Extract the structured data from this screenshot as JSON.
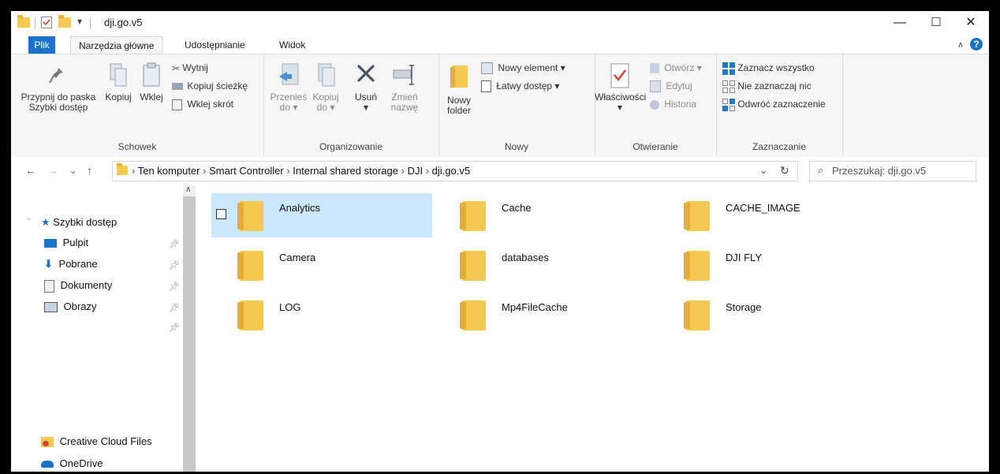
{
  "window": {
    "title": "dji.go.v5",
    "controls": {
      "minimize": "—",
      "maximize": "☐",
      "close": "✕"
    }
  },
  "tabs": [
    {
      "label": "Plik"
    },
    {
      "label": "Narzędzia główne"
    },
    {
      "label": "Udostępnianie"
    },
    {
      "label": "Widok"
    }
  ],
  "ribbon": {
    "schowek": {
      "label": "Schowek",
      "pin_line1": "Przypnij do paska",
      "pin_line2": "Szybki dostęp",
      "copy": "Kopiuj",
      "paste": "Wklej",
      "cut": "Wytnij",
      "copy_path": "Kopiuj ścieżkę",
      "paste_shortcut": "Wklej skrót"
    },
    "organizowanie": {
      "label": "Organizowanie",
      "move_line1": "Przenieś",
      "move_line2": "do",
      "copy_line1": "Kopiuj",
      "copy_line2": "do",
      "delete": "Usuń",
      "rename_line1": "Zmień",
      "rename_line2": "nazwę"
    },
    "nowy": {
      "label": "Nowy",
      "new_folder_line1": "Nowy",
      "new_folder_line2": "folder",
      "new_item": "Nowy element",
      "easy_access": "Łatwy dostęp"
    },
    "otwieranie": {
      "label": "Otwieranie",
      "properties": "Właściwości",
      "open": "Otwórz",
      "edit": "Edytuj",
      "history": "Historia"
    },
    "zaznaczanie": {
      "label": "Zaznaczanie",
      "select_all": "Zaznacz wszystko",
      "select_none": "Nie zaznaczaj nic",
      "invert": "Odwróć zaznaczenie"
    }
  },
  "address": {
    "crumbs": [
      "Ten komputer",
      "Smart Controller",
      "Internal shared storage",
      "DJI",
      "dji.go.v5"
    ],
    "search_placeholder": "Przeszukaj: dji.go.v5"
  },
  "navpane": {
    "quick_access": "Szybki dostęp",
    "items": [
      {
        "label": "Pulpit"
      },
      {
        "label": "Pobrane"
      },
      {
        "label": "Dokumenty"
      },
      {
        "label": "Obrazy"
      }
    ],
    "creative_cloud": "Creative Cloud Files",
    "onedrive": "OneDrive"
  },
  "folders": [
    {
      "name": "Analytics",
      "selected": true
    },
    {
      "name": "Cache"
    },
    {
      "name": "CACHE_IMAGE"
    },
    {
      "name": "Camera"
    },
    {
      "name": "databases"
    },
    {
      "name": "DJI FLY"
    },
    {
      "name": "LOG"
    },
    {
      "name": "Mp4FileCache"
    },
    {
      "name": "Storage"
    }
  ],
  "colors": {
    "accent": "#1a73c9",
    "selection": "#cce8ff",
    "folder": "#f3c94f"
  }
}
